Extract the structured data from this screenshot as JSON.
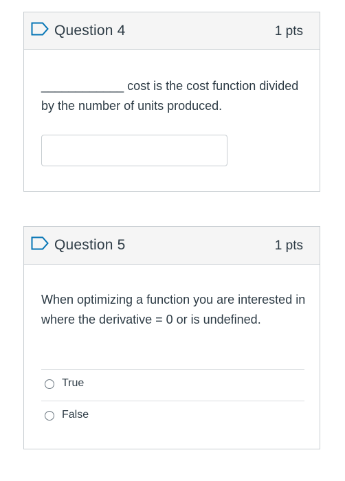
{
  "questions": [
    {
      "title": "Question 4",
      "points": "1 pts",
      "text": "____________ cost is the cost function divided by the number of units produced.",
      "answer_value": ""
    },
    {
      "title": "Question 5",
      "points": "1 pts",
      "text": "When optimizing a function you are interested in where the derivative = 0 or is undefined.",
      "options": [
        "True",
        "False"
      ]
    }
  ],
  "icons": {
    "flag": "bookmark-flag-icon",
    "radio": "radio-unselected-icon"
  },
  "colors": {
    "accent": "#0374b5",
    "header_bg": "#f5f5f5",
    "border": "#c7cdd1",
    "text": "#2d3b45"
  }
}
